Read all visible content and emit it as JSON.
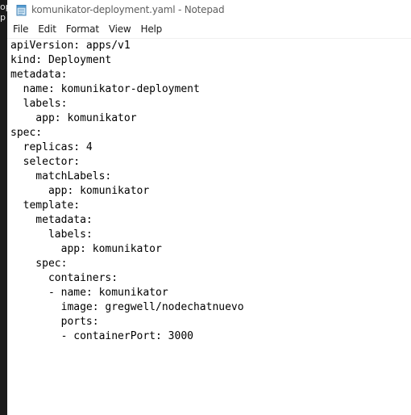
{
  "background_window": {
    "edge_glyphs": [
      "op",
      "p"
    ]
  },
  "window": {
    "title": "komunikator-deployment.yaml - Notepad",
    "app_icon": "notepad-icon"
  },
  "menu": {
    "items": [
      "File",
      "Edit",
      "Format",
      "View",
      "Help"
    ]
  },
  "editor": {
    "lines": [
      "apiVersion: apps/v1",
      "kind: Deployment",
      "metadata:",
      "  name: komunikator-deployment",
      "  labels:",
      "    app: komunikator",
      "spec:",
      "  replicas: 4",
      "  selector:",
      "    matchLabels:",
      "      app: komunikator",
      "  template:",
      "    metadata:",
      "      labels:",
      "        app: komunikator",
      "    spec:",
      "      containers:",
      "      - name: komunikator",
      "        image: gregwell/nodechatnuevo",
      "        ports:",
      "        - containerPort: 3000"
    ]
  }
}
